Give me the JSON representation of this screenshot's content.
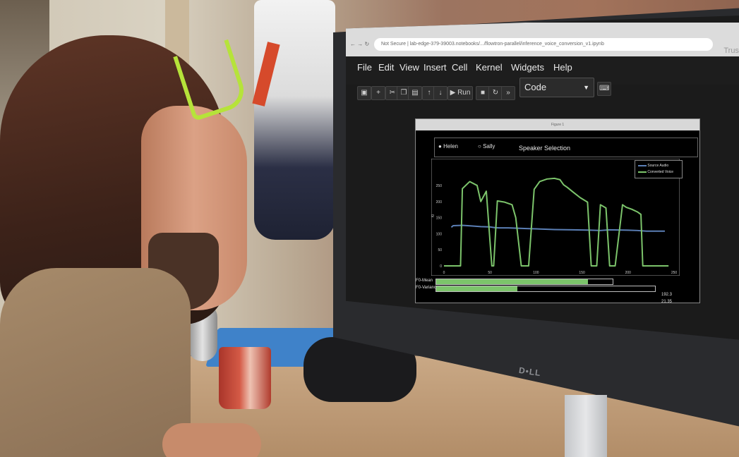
{
  "browser": {
    "address": "Not Secure | lab-edge-379-39003.notebooks/.../flowtron-parallel/inference_voice_conversion_v1.ipynb",
    "trusted_label": "Trust"
  },
  "notebook": {
    "menu": [
      "File",
      "Edit",
      "View",
      "Insert",
      "Cell",
      "Kernel",
      "Widgets",
      "Help"
    ],
    "run_label": "Run",
    "cell_type": "Code"
  },
  "figure": {
    "title": "Figure 1",
    "speakers": [
      "Helen",
      "Sally"
    ],
    "selection_label": "Speaker Selection",
    "sliders": [
      {
        "label": "F0-Mean",
        "value_text": "192.3",
        "value": 0.86
      },
      {
        "label": "F0-Variance",
        "value_text": "21.35",
        "value": 0.37
      }
    ]
  },
  "chart_data": {
    "type": "line",
    "ylabel": "f0",
    "xlim": [
      0,
      250
    ],
    "ylim": [
      0,
      320
    ],
    "x_ticks": [
      "0",
      "50",
      "100",
      "150",
      "200",
      "250"
    ],
    "y_ticks": [
      "0",
      "50",
      "100",
      "150",
      "200",
      "250"
    ],
    "legend": "top-right",
    "grid": false,
    "series": [
      {
        "name": "Source Audio",
        "color": "#5b7fb5",
        "x": [
          8,
          10,
          20,
          30,
          40,
          50,
          55,
          60,
          70,
          80,
          90,
          100,
          110,
          120,
          140,
          160,
          170,
          180,
          200,
          210,
          220,
          230,
          240
        ],
        "y": [
          120,
          125,
          126,
          124,
          122,
          121,
          119,
          118,
          118,
          117,
          116,
          115,
          114,
          113,
          112,
          111,
          110,
          112,
          111,
          110,
          108,
          108,
          108
        ]
      },
      {
        "name": "Converted Voice",
        "color": "#7cc46b",
        "x": [
          0,
          18,
          20,
          28,
          36,
          40,
          46,
          52,
          54,
          58,
          66,
          74,
          78,
          84,
          92,
          98,
          104,
          112,
          120,
          126,
          130,
          134,
          140,
          148,
          156,
          160,
          166,
          170,
          176,
          180,
          186,
          194,
          198,
          204,
          210,
          214,
          216,
          224,
          232,
          238,
          244
        ],
        "y": [
          0,
          0,
          240,
          262,
          250,
          200,
          232,
          0,
          0,
          202,
          198,
          190,
          150,
          0,
          0,
          238,
          262,
          270,
          272,
          268,
          252,
          244,
          230,
          212,
          198,
          0,
          0,
          190,
          180,
          0,
          0,
          190,
          182,
          176,
          168,
          160,
          0,
          0,
          0,
          0,
          0
        ]
      }
    ]
  },
  "colors": {
    "accent_green": "#7cc46b",
    "glasses": "#b6e33a",
    "source_blue": "#5b7fb5"
  },
  "icons": [
    "save-icon",
    "add-icon",
    "cut-icon",
    "copy-icon",
    "paste-icon",
    "move-up-icon",
    "move-down-icon",
    "run-icon",
    "stop-icon",
    "restart-icon",
    "fast-forward-icon",
    "keyboard-icon"
  ]
}
